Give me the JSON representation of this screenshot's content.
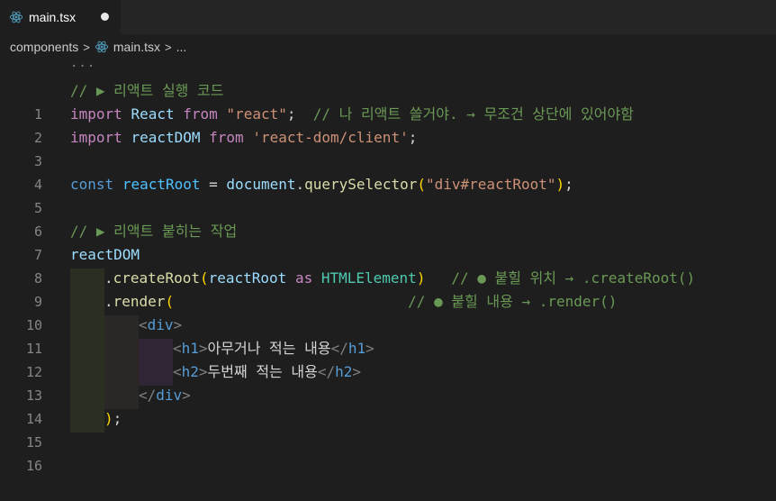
{
  "tab": {
    "filename": "main.tsx"
  },
  "breadcrumb": {
    "folder": "components",
    "separator": ">",
    "file": "main.tsx",
    "trailing": "..."
  },
  "editor": {
    "fold_indicator": "...",
    "line_numbers": [
      "1",
      "2",
      "3",
      "4",
      "5",
      "6",
      "7",
      "8",
      "9",
      "10",
      "11",
      "12",
      "13",
      "14",
      "15",
      "16"
    ],
    "lines": {
      "l1": {
        "comment": "// ▶ 리액트 실행 코드"
      },
      "l2": {
        "kw1": "import",
        "id": "React",
        "kw2": "from",
        "str": "\"react\"",
        "semi": ";",
        "comment": "  // 나 리액트 쓸거야. → 무조건 상단에 있어야함"
      },
      "l3": {
        "kw1": "import",
        "id": "reactDOM",
        "kw2": "from",
        "str": "'react-dom/client'",
        "semi": ";"
      },
      "l5": {
        "kw": "const",
        "id": "reactRoot",
        "eq": " = ",
        "obj": "document",
        "dot": ".",
        "fn": "querySelector",
        "open": "(",
        "str": "\"div#reactRoot\"",
        "close": ")",
        "semi": ";"
      },
      "l7": {
        "comment": "// ▶ 리액트 붙히는 작업"
      },
      "l8": {
        "id": "reactDOM"
      },
      "l9": {
        "dot": ".",
        "fn": "createRoot",
        "open": "(",
        "id": "reactRoot",
        "as": " as ",
        "type": "HTMLElement",
        "close": ")",
        "comment": "   // ● 붙힐 위치 → .createRoot()"
      },
      "l10": {
        "dot": ".",
        "fn": "render",
        "open": "(",
        "comment": "                           // ● 붙힐 내용 → .render()"
      },
      "l11": {
        "lt": "<",
        "tag": "div",
        "gt": ">"
      },
      "l12": {
        "lt": "<",
        "tag": "h1",
        "gt": ">",
        "text": "아무거나 적는 내용",
        "clt": "</",
        "ctag": "h1",
        "cgt": ">"
      },
      "l13": {
        "lt": "<",
        "tag": "h2",
        "gt": ">",
        "text": "두번째 적는 내용",
        "clt": "</",
        "ctag": "h2",
        "cgt": ">"
      },
      "l14": {
        "lt": "</",
        "tag": "div",
        "gt": ">"
      },
      "l15": {
        "close": ")",
        "semi": ";"
      }
    }
  },
  "colors": {
    "background": "#1e1e1e",
    "comment": "#6a9955",
    "keyword": "#c586c0",
    "storage": "#569cd6",
    "variable": "#9cdcfe",
    "function": "#dcdcaa",
    "string": "#ce9178",
    "type": "#4ec9b0",
    "bracket": "#ffd700"
  },
  "icons": {
    "tab_icon": "react-icon",
    "breadcrumb_icon": "react-icon"
  }
}
